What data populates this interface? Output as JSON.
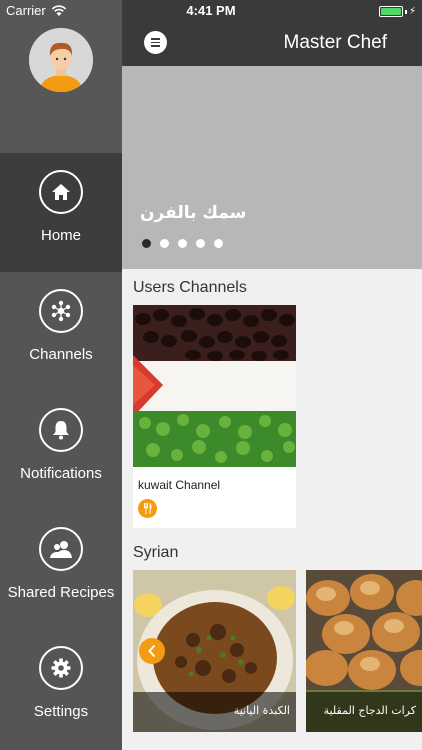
{
  "status_bar": {
    "carrier": "Carrier",
    "time": "4:41 PM"
  },
  "sidebar": {
    "items": [
      {
        "label": "Home",
        "icon": "home-icon",
        "active": true
      },
      {
        "label": "Channels",
        "icon": "channels-icon",
        "active": false
      },
      {
        "label": "Notifications",
        "icon": "bell-icon",
        "active": false
      },
      {
        "label": "Shared Recipes",
        "icon": "shared-users-icon",
        "active": false
      },
      {
        "label": "Settings",
        "icon": "gear-icon",
        "active": false
      }
    ]
  },
  "navbar": {
    "title": "Master Chef"
  },
  "banner": {
    "caption": "سمك بالفرن",
    "slide_count": 5,
    "active_slide": 1
  },
  "users_channels": {
    "title": "Users Channels",
    "cards": [
      {
        "name": "kuwait Channel",
        "badge_icon": "cutlery-icon"
      }
    ]
  },
  "syrian": {
    "title": "Syrian",
    "tiles": [
      {
        "caption": "الكبدة اليانية"
      },
      {
        "caption": "كرات الدجاج المقلية"
      }
    ]
  },
  "colors": {
    "accent": "#f39c12",
    "sidebar": "#555555",
    "sidebar_active": "#3d3d3d",
    "navbar": "#3a3a3a"
  }
}
